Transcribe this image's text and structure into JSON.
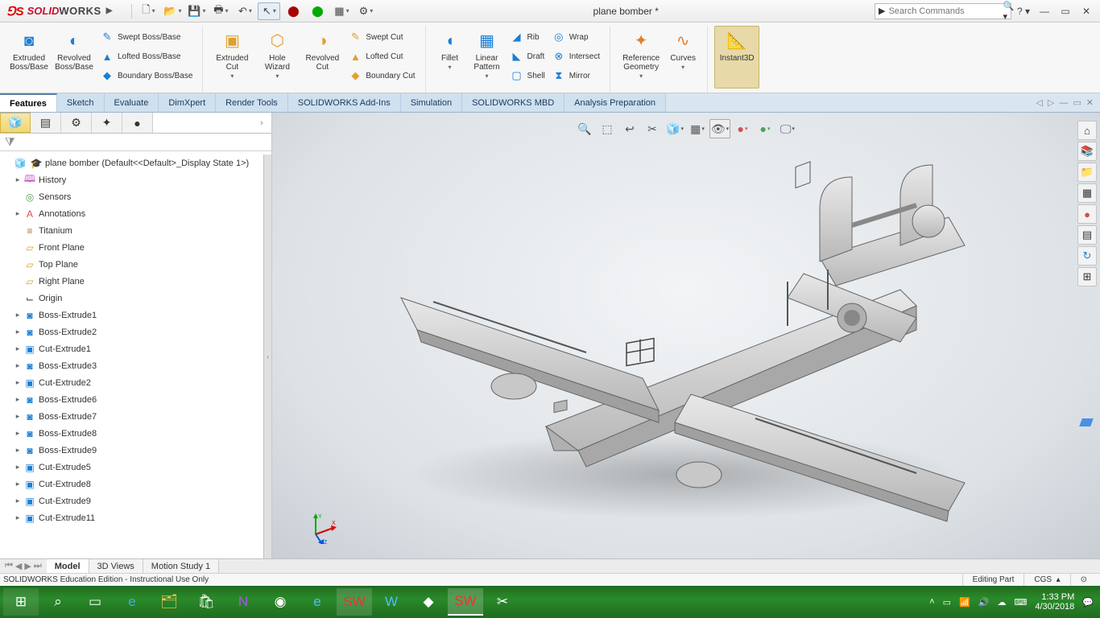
{
  "title_doc": "plane bomber *",
  "logo_brand1": "SOLID",
  "logo_brand2": "WORKS",
  "search_placeholder": "Search Commands",
  "ribbon": {
    "extruded_boss": "Extruded Boss/Base",
    "revolved_boss": "Revolved Boss/Base",
    "swept_boss": "Swept Boss/Base",
    "lofted_boss": "Lofted Boss/Base",
    "boundary_boss": "Boundary Boss/Base",
    "extruded_cut": "Extruded Cut",
    "hole_wizard": "Hole Wizard",
    "revolved_cut": "Revolved Cut",
    "swept_cut": "Swept Cut",
    "lofted_cut": "Lofted Cut",
    "boundary_cut": "Boundary Cut",
    "fillet": "Fillet",
    "linear_pattern": "Linear Pattern",
    "rib": "Rib",
    "draft": "Draft",
    "shell": "Shell",
    "wrap": "Wrap",
    "intersect": "Intersect",
    "mirror": "Mirror",
    "ref_geometry": "Reference Geometry",
    "curves": "Curves",
    "instant3d": "Instant3D"
  },
  "tabs": {
    "features": "Features",
    "sketch": "Sketch",
    "evaluate": "Evaluate",
    "dimxpert": "DimXpert",
    "render": "Render Tools",
    "addins": "SOLIDWORKS Add-Ins",
    "simulation": "Simulation",
    "mbd": "SOLIDWORKS MBD",
    "analysis": "Analysis Preparation"
  },
  "tree_root": "plane bomber  (Default<<Default>_Display State 1>)",
  "tree": {
    "history": "History",
    "sensors": "Sensors",
    "annotations": "Annotations",
    "material": "Titanium",
    "front": "Front Plane",
    "top": "Top Plane",
    "right": "Right Plane",
    "origin": "Origin",
    "be1": "Boss-Extrude1",
    "be2": "Boss-Extrude2",
    "ce1": "Cut-Extrude1",
    "be3": "Boss-Extrude3",
    "ce2": "Cut-Extrude2",
    "be6": "Boss-Extrude6",
    "be7": "Boss-Extrude7",
    "be8": "Boss-Extrude8",
    "be9": "Boss-Extrude9",
    "ce5": "Cut-Extrude5",
    "ce8": "Cut-Extrude8",
    "ce9": "Cut-Extrude9",
    "ce11": "Cut-Extrude11"
  },
  "bottom_tabs": {
    "model": "Model",
    "views3d": "3D Views",
    "motion": "Motion Study 1"
  },
  "status": {
    "edition": "SOLIDWORKS Education Edition - Instructional Use Only",
    "editing": "Editing Part",
    "units": "CGS"
  },
  "clock": {
    "time": "1:33 PM",
    "date": "4/30/2018"
  }
}
